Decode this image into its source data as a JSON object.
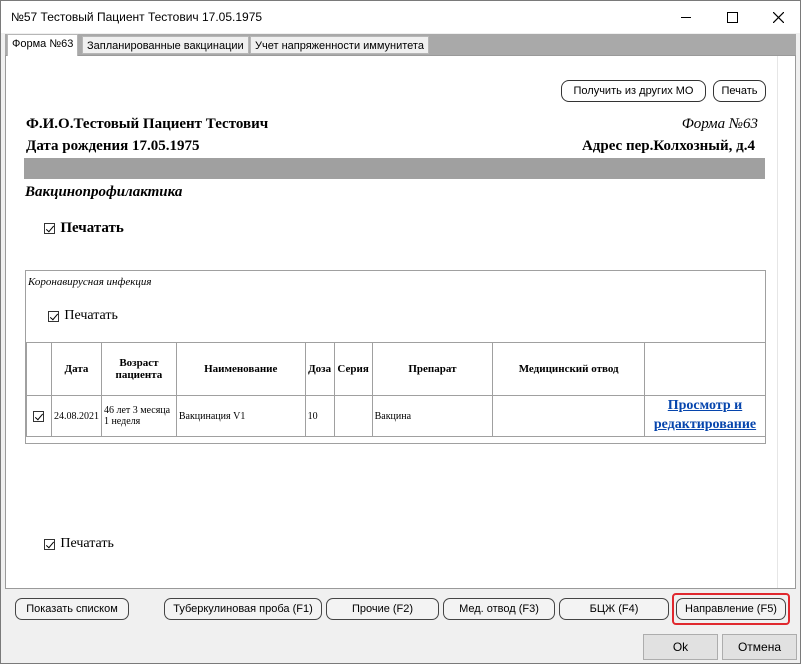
{
  "window": {
    "title": "№57 Тестовый Пациент Тестович 17.05.1975"
  },
  "tabs": [
    "Форма №63",
    "Запланированные вакцинации",
    "Учет напряженности иммунитета"
  ],
  "toolbar": {
    "get_other_mo": "Получить из других МО",
    "print": "Печать"
  },
  "patient": {
    "fio": "Ф.И.О.Тестовый Пациент Тестович",
    "form": "Форма №63",
    "birth": "Дата рождения 17.05.1975",
    "address": "Адрес пер.Колхозный, д.4"
  },
  "section": {
    "title": "Вакцинопрофилактика",
    "print_label": "Печатать"
  },
  "infection": {
    "title": "Коронавирусная инфекция",
    "print_label": "Печатать",
    "headers": [
      "Дата",
      "Возраст пациента",
      "Наименование",
      "Доза",
      "Серия",
      "Препарат",
      "Медицинский отвод"
    ],
    "row": {
      "date": "24.08.2021",
      "age": "46 лет 3 месяца 1 неделя",
      "name": "Вакцинация V1",
      "dose": "10",
      "series": "",
      "drug": "Вакцина",
      "medical_exemption": "",
      "link": "Просмотр и редактирование"
    }
  },
  "bottom_print_label": "Печатать",
  "buttons": {
    "show_list": "Показать списком",
    "tb": "Туберкулиновая проба (F1)",
    "other": "Прочие (F2)",
    "med": "Мед. отвод (F3)",
    "bcg": "БЦЖ (F4)",
    "direction": "Направление (F5)",
    "ok": "Ok",
    "cancel": "Отмена"
  },
  "colors": {
    "highlight": "#e0282e",
    "band": "#a0a0a0",
    "link": "#0645ad"
  }
}
